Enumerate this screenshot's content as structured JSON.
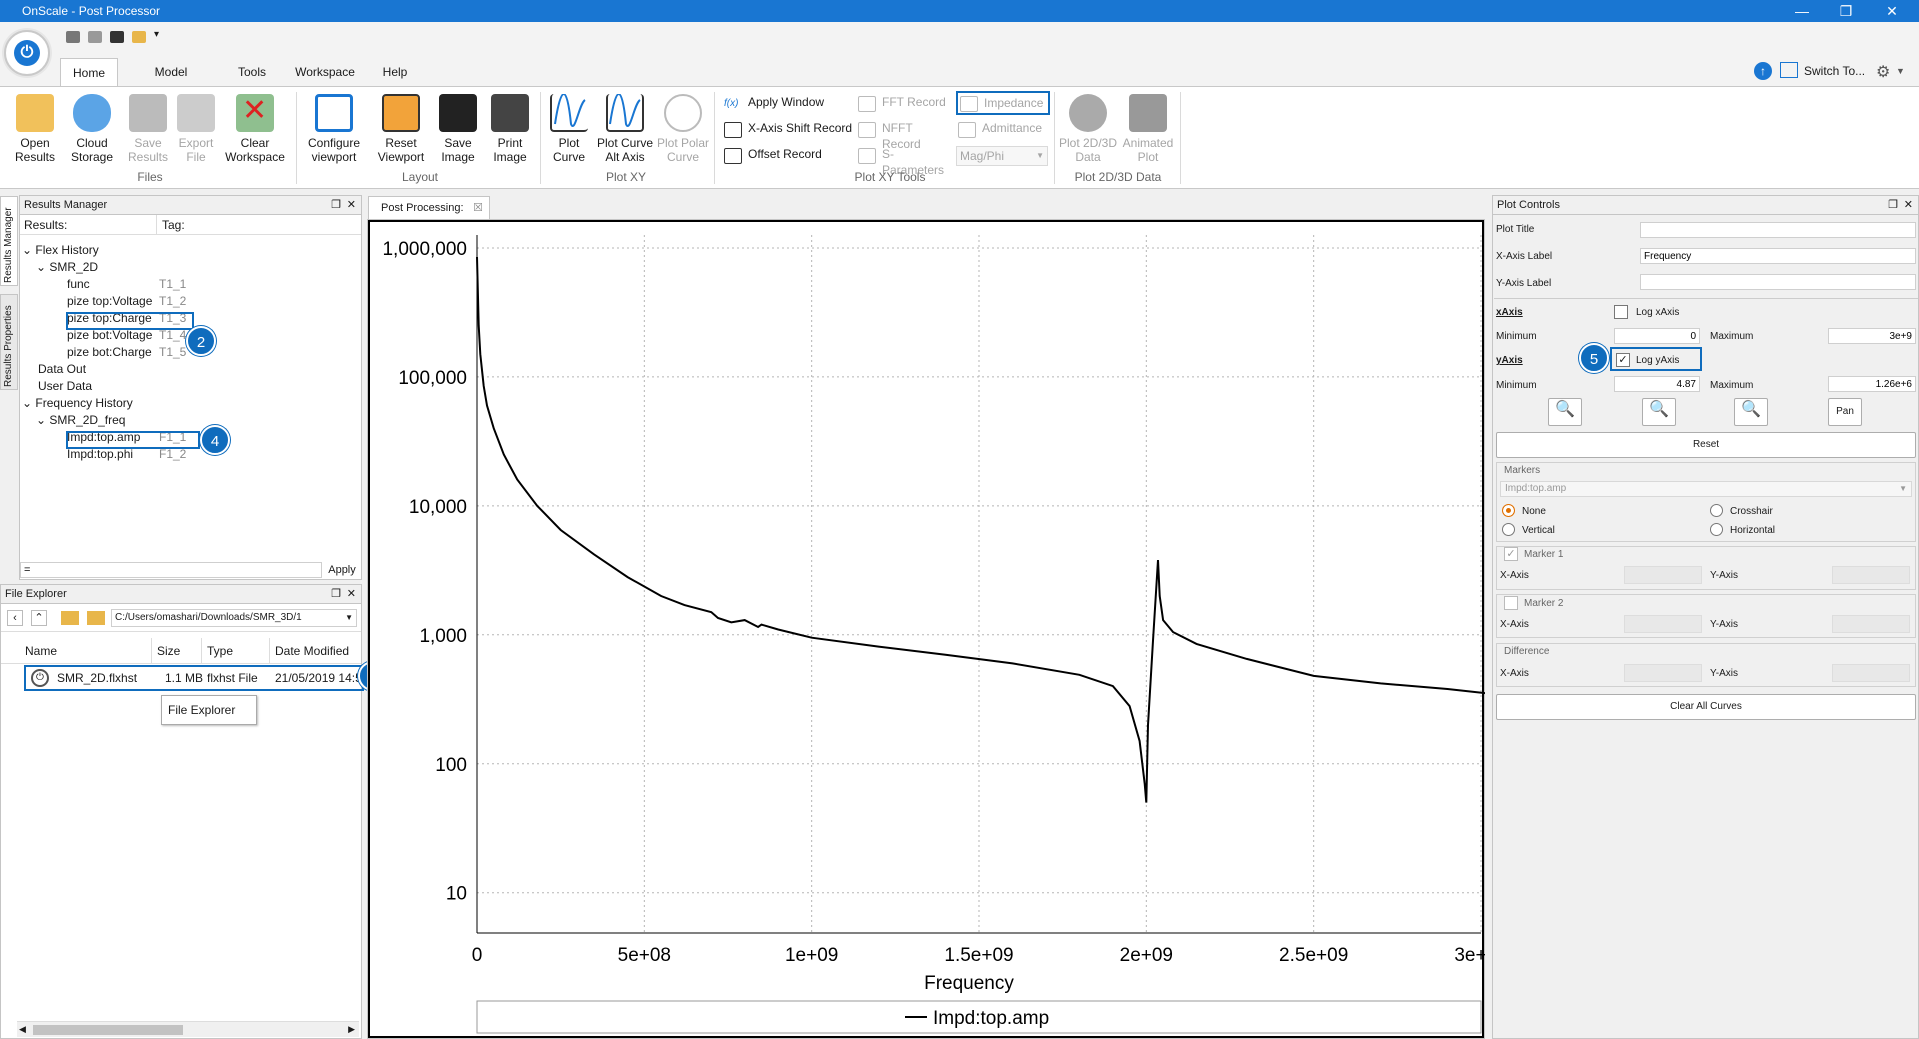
{
  "window": {
    "title": "OnScale - Post Processor"
  },
  "menu_tabs": [
    {
      "label": "Home"
    },
    {
      "label": "Model Graphics"
    },
    {
      "label": "Tools"
    },
    {
      "label": "Workspace"
    },
    {
      "label": "Help"
    }
  ],
  "switch_to": "Switch To...",
  "ribbon": {
    "files": {
      "group": "Files",
      "open": "Open Results",
      "cloud": "Cloud Storage",
      "save": "Save Results",
      "export": "Export File",
      "clear": "Clear Workspace"
    },
    "layout": {
      "group": "Layout",
      "configure": "Configure viewport",
      "reset": "Reset Viewport",
      "save_image": "Save Image",
      "print": "Print Image"
    },
    "plotxy": {
      "group": "Plot XY",
      "curve": "Plot Curve",
      "alt": "Plot Curve Alt Axis",
      "polar": "Plot Polar Curve"
    },
    "tools": {
      "group": "Plot XY Tools",
      "apply_window": "Apply Window",
      "xshift": "X-Axis Shift Record",
      "offset": "Offset Record",
      "fft": "FFT Record",
      "nfft": "NFFT Record",
      "sparams": "S-Parameters",
      "impedance": "Impedance",
      "admittance": "Admittance",
      "magphi": "Mag/Phi"
    },
    "plot23": {
      "group": "Plot 2D/3D Data",
      "data": "Plot 2D/3D Data",
      "anim": "Animated Plot"
    }
  },
  "side_tabs": {
    "manager": "Results Manager",
    "properties": "Results Properties"
  },
  "results_manager": {
    "title": "Results Manager",
    "col_results": "Results:",
    "col_tag": "Tag:",
    "flex": "Flex History",
    "smr2d": "SMR_2D",
    "items": [
      {
        "name": "func",
        "tag": "T1_1"
      },
      {
        "name": "pize top:Voltage",
        "tag": "T1_2"
      },
      {
        "name": "pize top:Charge",
        "tag": "T1_3"
      },
      {
        "name": "pize bot:Voltage",
        "tag": "T1_4"
      },
      {
        "name": "pize bot:Charge",
        "tag": "T1_5"
      }
    ],
    "data_out": "Data Out",
    "user_data": "User Data",
    "freq": "Frequency History",
    "smr2dfreq": "SMR_2D_freq",
    "freq_items": [
      {
        "name": "Impd:top.amp",
        "tag": "F1_1"
      },
      {
        "name": "Impd:top.phi",
        "tag": "F1_2"
      }
    ],
    "filter_value": "=",
    "apply": "Apply"
  },
  "file_explorer": {
    "title": "File Explorer",
    "path": "C:/Users/omashari/Downloads/SMR_3D/1",
    "cols": [
      "Name",
      "Size",
      "Type",
      "Date Modified"
    ],
    "file": {
      "name": "SMR_2D.flxhst",
      "size": "1.1 MB",
      "type": "flxhst File",
      "date": "21/05/2019 14:58"
    },
    "tooltip": "File Explorer"
  },
  "badges": [
    "1",
    "2",
    "3",
    "4",
    "5"
  ],
  "post_tab": "Post Processing:",
  "chart_data": {
    "type": "line",
    "xlabel": "Frequency",
    "xlim": [
      0,
      3000000000
    ],
    "ylim": [
      4.87,
      1260000
    ],
    "yscale": "log",
    "x_ticks": [
      "0",
      "5e+08",
      "1e+09",
      "1.5e+09",
      "2e+09",
      "2.5e+09",
      "3e+09"
    ],
    "y_ticks": [
      "10",
      "100",
      "1,000",
      "10,000",
      "100,000",
      "1,000,000"
    ],
    "series": [
      {
        "name": "Impd:top.amp",
        "color": "#000000",
        "x": [
          0,
          5000000,
          10000000,
          20000000,
          30000000,
          50000000,
          80000000,
          120000000,
          180000000,
          250000000,
          350000000,
          450000000,
          550000000,
          620000000,
          700000000,
          720000000,
          760000000,
          800000000,
          840000000,
          850000000,
          900000000,
          1000000000,
          1200000000,
          1400000000,
          1600000000,
          1800000000,
          1900000000,
          1950000000,
          1980000000,
          1995000000,
          2000000000,
          2005000000,
          2020000000,
          2035000000,
          2040000000,
          2050000000,
          2080000000,
          2150000000,
          2300000000,
          2500000000,
          2700000000,
          2900000000,
          3070000000
        ],
        "y": [
          850000,
          250000,
          150000,
          85000,
          60000,
          40000,
          25000,
          16000,
          10000,
          6500,
          4200,
          2800,
          2000,
          1700,
          1500,
          1350,
          1250,
          1300,
          1150,
          1200,
          1100,
          950,
          810,
          700,
          600,
          490,
          400,
          280,
          150,
          70,
          50,
          200,
          900,
          3800,
          2000,
          1300,
          1050,
          850,
          650,
          480,
          420,
          380,
          340
        ]
      }
    ]
  },
  "plot_controls": {
    "title": "Plot Controls",
    "plot_title_label": "Plot Title",
    "plot_title": "",
    "xaxis_label": "X-Axis Label",
    "xaxis_value": "Frequency",
    "yaxis_label": "Y-Axis Label",
    "yaxis_value": "",
    "xaxis": "xAxis",
    "log_x": "Log xAxis",
    "x_min_label": "Minimum",
    "x_min": "0",
    "x_max_label": "Maximum",
    "x_max": "3e+9",
    "yaxis": "yAxis",
    "log_y": "Log yAxis",
    "y_min_label": "Minimum",
    "y_min": "4.87",
    "y_max_label": "Maximum",
    "y_max": "1.26e+6",
    "pan": "Pan",
    "reset": "Reset",
    "markers": "Markers",
    "marker_select": "Impd:top.amp",
    "none": "None",
    "crosshair": "Crosshair",
    "vertical": "Vertical",
    "horizontal": "Horizontal",
    "marker1": "Marker 1",
    "marker2": "Marker 2",
    "difference": "Difference",
    "xaxis_s": "X-Axis",
    "yaxis_s": "Y-Axis",
    "clear": "Clear All Curves"
  }
}
